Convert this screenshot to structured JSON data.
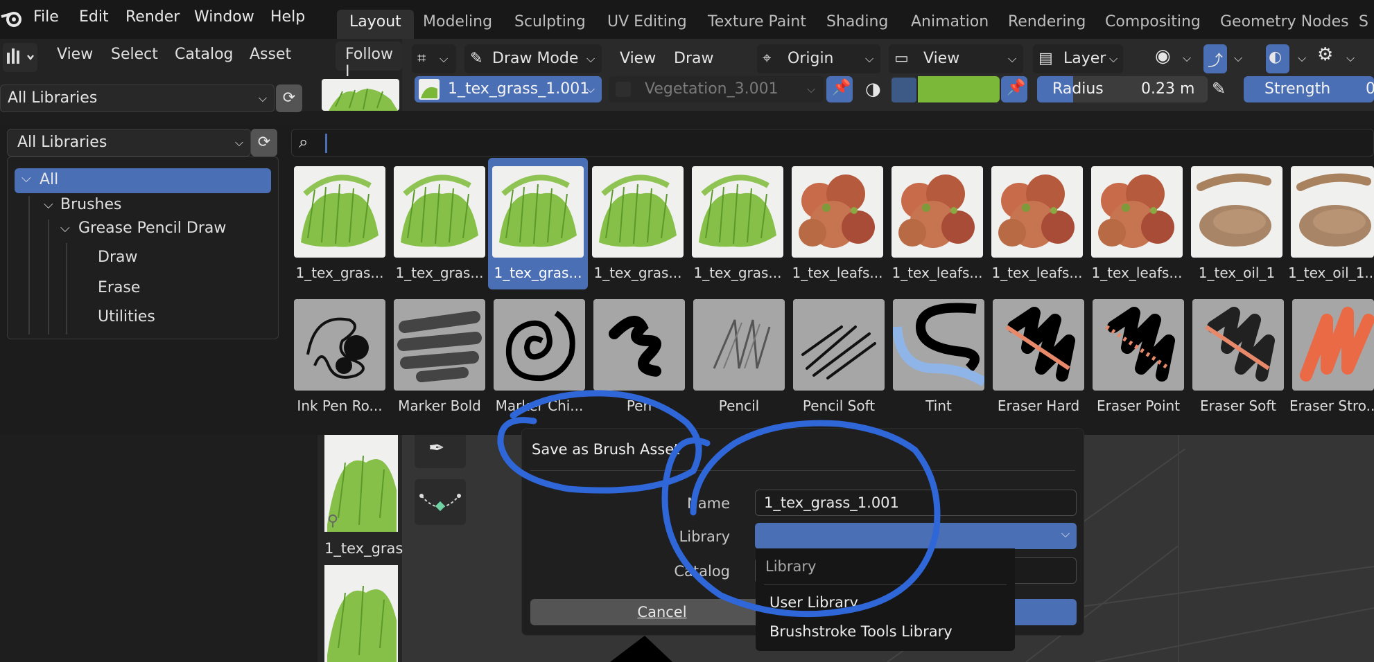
{
  "menubar": {
    "items": [
      "File",
      "Edit",
      "Render",
      "Window",
      "Help"
    ]
  },
  "workspaces": {
    "tabs": [
      "Layout",
      "Modeling",
      "Sculpting",
      "UV Editing",
      "Texture Paint",
      "Shading",
      "Animation",
      "Rendering",
      "Compositing",
      "Geometry Nodes",
      "S"
    ],
    "active": "Layout"
  },
  "asset_header": {
    "menu": [
      "View",
      "Select",
      "Catalog",
      "Asset"
    ],
    "follow_label": "Follow I",
    "library_dropdown": "All Libraries"
  },
  "viewport_header": {
    "mode": "Draw Mode",
    "view_label": "View",
    "draw_label": "Draw",
    "origin_label": "Origin",
    "view2_label": "View",
    "layer_label": "Layer",
    "brush_name": "1_tex_grass_1.001",
    "material_name": "Vegetation_3.001",
    "radius_label": "Radius",
    "radius_value": "0.23 m",
    "strength_label": "Strength",
    "strength_value": "0"
  },
  "asset_popup": {
    "library_dropdown": "All Libraries",
    "tree": [
      "All",
      "Brushes",
      "Grease Pencil Draw",
      "Draw",
      "Erase",
      "Utilities"
    ],
    "row1_labels": [
      "1_tex_gras...",
      "1_tex_gras...",
      "1_tex_gras...",
      "1_tex_gras...",
      "1_tex_gras...",
      "1_tex_leafs...",
      "1_tex_leafs...",
      "1_tex_leafs...",
      "1_tex_leafs...",
      "1_tex_oil_1",
      "1_tex_oil_1..."
    ],
    "row2_labels": [
      "Ink Pen Ro...",
      "Marker Bold",
      "Marker Chi...",
      "Pen",
      "Pencil",
      "Pencil Soft",
      "Tint",
      "Eraser Hard",
      "Eraser Point",
      "Eraser Soft",
      "Eraser Stro..."
    ]
  },
  "side_panel": {
    "label": "1_tex_gras"
  },
  "dialog": {
    "title": "Save as Brush Asset",
    "name_label": "Name",
    "name_value": "1_tex_grass_1.001",
    "library_label": "Library",
    "catalog_label": "Catalog",
    "cancel_label": "Cancel"
  },
  "library_menu": {
    "header": "Library",
    "options": [
      "User Library",
      "Brushstroke Tools Library"
    ]
  },
  "colors": {
    "accent_blue": "#4a6fb5",
    "annotation_blue": "#2f66d8",
    "material_green": "#7bb83a"
  }
}
